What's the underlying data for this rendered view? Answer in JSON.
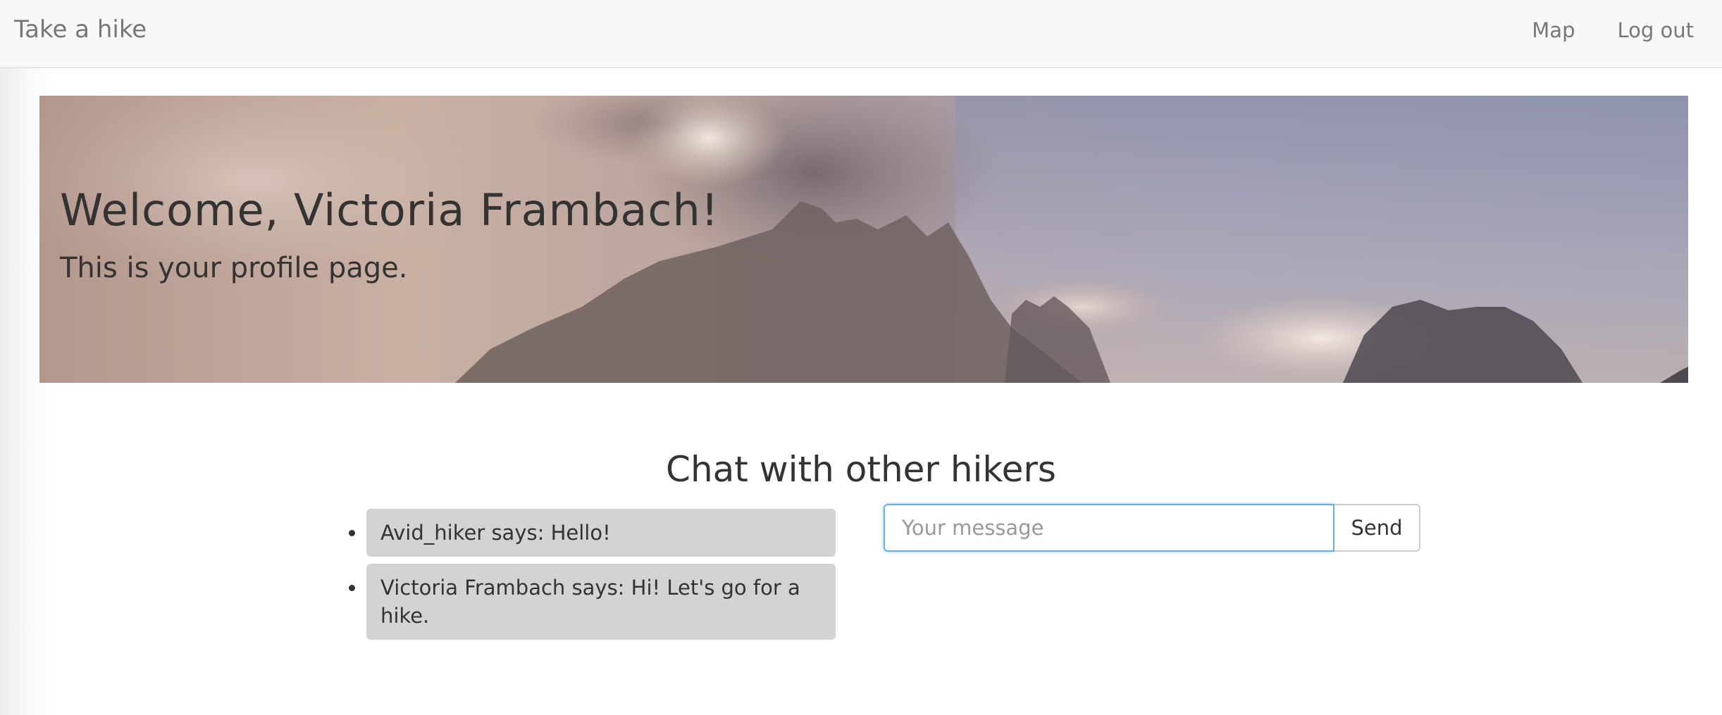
{
  "navbar": {
    "brand": "Take a hike",
    "links": [
      {
        "label": "Map"
      },
      {
        "label": "Log out"
      }
    ]
  },
  "hero": {
    "title": "Welcome, Victoria Frambach!",
    "subtitle": "This is your profile page."
  },
  "chat": {
    "title": "Chat with other hikers",
    "messages": [
      {
        "text": "Avid_hiker says: Hello!"
      },
      {
        "text": "Victoria Frambach says: Hi! Let's go for a hike."
      }
    ],
    "input_placeholder": "Your message",
    "input_value": "",
    "send_label": "Send"
  },
  "colors": {
    "navbar_bg": "#f8f8f8",
    "nav_text": "#777777",
    "message_bubble": "#d3d3d3",
    "input_focus": "#66afe9",
    "text": "#333333"
  }
}
